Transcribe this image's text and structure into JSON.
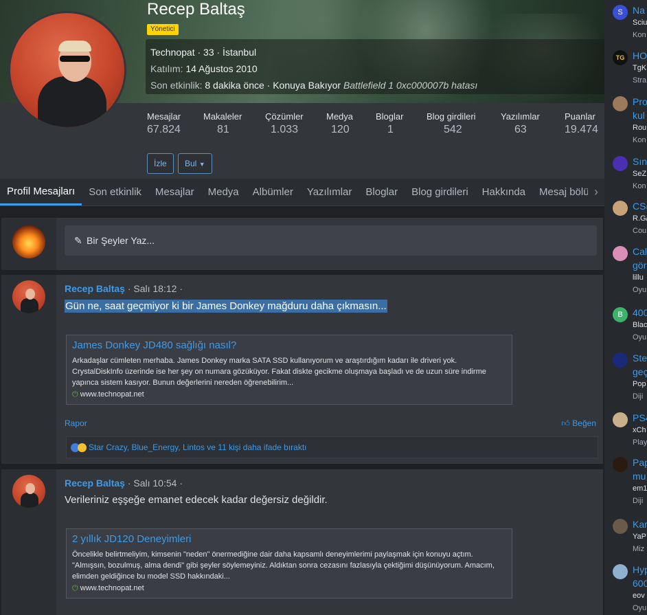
{
  "profile": {
    "name": "Recep Baltaş",
    "role": "Yönetici",
    "info_line1": "Technopat · 33 · İstanbul",
    "joined_label": "Katılım:",
    "joined_value": "14 Ağustos 2010",
    "last_label": "Son etkinlik:",
    "last_value": "8 dakika önce · Konuya Bakıyor",
    "last_thread": "Battlefield 1 0xc000007b hatası"
  },
  "stats": [
    {
      "label": "Mesajlar",
      "value": "67.824"
    },
    {
      "label": "Makaleler",
      "value": "81"
    },
    {
      "label": "Çözümler",
      "value": "1.033"
    },
    {
      "label": "Medya",
      "value": "120"
    },
    {
      "label": "Bloglar",
      "value": "1"
    },
    {
      "label": "Blog girdileri",
      "value": "542"
    },
    {
      "label": "Yazılımlar",
      "value": "63"
    },
    {
      "label": "Puanlar",
      "value": "19.474"
    }
  ],
  "buttons": {
    "watch": "İzle",
    "find": "Bul"
  },
  "tabs": [
    "Profil Mesajları",
    "Son etkinlik",
    "Mesajlar",
    "Medya",
    "Albümler",
    "Yazılımlar",
    "Bloglar",
    "Blog girdileri",
    "Hakkında",
    "Mesaj bölü"
  ],
  "composer": {
    "placeholder": "Bir Şeyler Yaz..."
  },
  "messages": [
    {
      "author": "Recep Baltaş",
      "time": "· Salı 18:12 ·",
      "text": "Gün ne, saat geçmiyor ki bir James Donkey mağduru daha çıkmasın...",
      "unfurl_title": "James Donkey JD480 sağlığı nasıl?",
      "unfurl_desc": "Arkadaşlar cümleten merhaba. James Donkey marka SATA SSD kullanıyorum ve araştırdığım kadarı ile driveri yok. CrystalDiskInfo üzerinde ise her şey on numara gözüküyor. Fakat diskte gecikme oluşmaya başladı ve de uzun süre indirme yapınca sistem kasıyor. Bunun değerlerini nereden öğrenebilirim...",
      "unfurl_source": "www.technopat.net",
      "report": "Rapor",
      "like": "Beğen",
      "reactions": "Star Crazy, Blue_Energy, Lintos ve 11 kişi daha ifade bıraktı"
    },
    {
      "author": "Recep Baltaş",
      "time": "· Salı 10:54 ·",
      "text": "Verileriniz eşşeğe emanet edecek kadar değersiz değildir.",
      "unfurl_title": "2 yıllık JD120 Deneyimleri",
      "unfurl_desc": "Öncelikle belirtmeliyim, kimsenin \"neden\" önermediğine dair daha kapsamlı deneyimlerimi paylaşmak için konuyu açtım. \"Almışsın, bozulmuş, alma dendi\" gibi şeyler söylemeyiniz. Aldıktan sonra cezasını fazlasıyla çektiğimi düşünüyorum. Amacım, elimden geldiğince bu model SSD hakkındaki...",
      "unfurl_source": "www.technopat.net"
    }
  ],
  "sidebar": [
    {
      "icon": "S",
      "color": "#3b4fd6",
      "title": "Na",
      "l2": "Sciu",
      "l3": "Kon"
    },
    {
      "icon": "TG",
      "color": "#111111",
      "title": "HO",
      "l2": "TgK",
      "l3": "Stra"
    },
    {
      "icon": "",
      "color": "#9a7a5a",
      "title": "Pro",
      "title2": "kul",
      "l2": "Rou",
      "l3": "Kon"
    },
    {
      "icon": "",
      "color": "#4a2fb0",
      "title": "Sın",
      "l2": "SeZ",
      "l3": "Kon"
    },
    {
      "icon": "",
      "color": "#c9a27a",
      "title": "CS(",
      "l2": "R.G/",
      "l3": "Cou"
    },
    {
      "icon": "",
      "color": "#d98fb8",
      "title": "Cal",
      "title2": "gör",
      "l2": "lillu",
      "l3": "Oyu"
    },
    {
      "icon": "B",
      "color": "#3db36a",
      "title": "400",
      "l2": "Blac",
      "l3": "Oyu"
    },
    {
      "icon": "",
      "color": "#1a2a7a",
      "title": "Ste",
      "title2": "geç",
      "l2": "Pop",
      "l3": "Diji"
    },
    {
      "icon": "",
      "color": "#c9b08a",
      "title": "PS4",
      "l2": "xCh",
      "l3": "Play"
    },
    {
      "icon": "",
      "color": "#2a1a10",
      "title": "Pap",
      "title2": "mu",
      "l2": "em1",
      "l3": "Diji"
    },
    {
      "icon": "",
      "color": "#6a5a4a",
      "title": "Kar",
      "l2": "YaP",
      "l3": "Miz"
    },
    {
      "icon": "",
      "color": "#8fb0d0",
      "title": "Hyp",
      "title2": "600",
      "l2": "eov",
      "l3": "Oyu"
    }
  ]
}
